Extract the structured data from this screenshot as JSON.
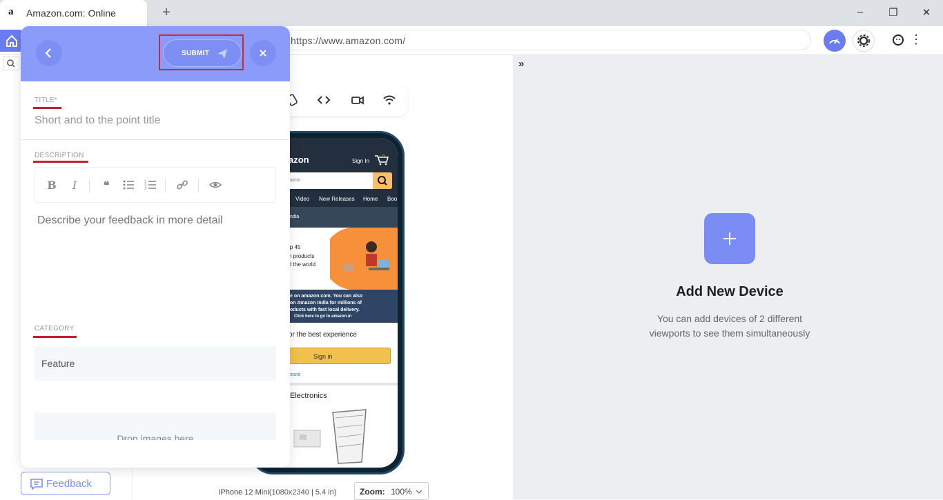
{
  "browser": {
    "tab_favicon": "a",
    "tab_title": "Amazon.com: Online",
    "new_tab": "+",
    "url": "https://www.amazon.com/",
    "window_controls": {
      "minimize": "–",
      "restore": "❐",
      "close": "✕"
    }
  },
  "feedback_form": {
    "submit_label": "SUBMIT",
    "title_label": "TITLE*",
    "title_placeholder": "Short and to the point title",
    "description_label": "DESCRIPTION",
    "description_placeholder": "Describe your feedback in more detail",
    "editor_tools": [
      "bold",
      "italic",
      "quote",
      "bulleted-list",
      "numbered-list",
      "link",
      "preview"
    ],
    "category_label": "CATEGORY",
    "category_value": "Feature",
    "drop_text": "Drop images here"
  },
  "feedback_button_label": "Feedback",
  "phone_preview": {
    "brand": "azon",
    "signin": "Sign In",
    "cart_count": "0",
    "search_placeholder": "azon",
    "nav": [
      "Video",
      "New Releases",
      "Home",
      "Boo"
    ],
    "location": "India",
    "banner_lines": [
      "ip 45",
      "n products",
      "d the world"
    ],
    "blue_lines": [
      "e on amazon.com. You can also",
      "on Amazon India for millions of",
      "oducts with fast local delivery.",
      "Click here to go to amazon.in"
    ],
    "best_experience": "or the best experience",
    "signin_button": "Sign in",
    "account_link": "count",
    "section_title": "Electronics"
  },
  "device": {
    "name": "iPhone 12 Mini",
    "spec": "(1080x2340 | 5.4 in)",
    "zoom_label": "Zoom:",
    "zoom_value": "100%"
  },
  "right_panel": {
    "add_title": "Add New Device",
    "add_desc_line1": "You can add devices of 2 different",
    "add_desc_line2": "viewports to see them simultaneously"
  },
  "colors": {
    "accent": "#8b9bfa",
    "accent_dark": "#7d8ef5",
    "highlight": "#e0202a",
    "underline": "#c41e2a"
  }
}
